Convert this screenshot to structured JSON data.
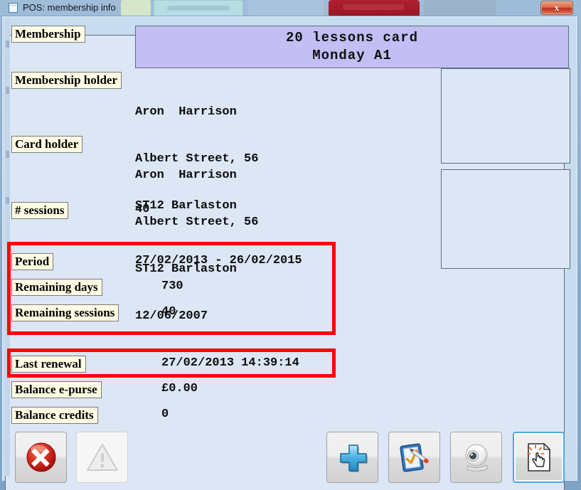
{
  "window": {
    "title": "POS: membership info",
    "icon": "window-icon",
    "close_label": "x"
  },
  "background_strips": [
    {
      "name": "bg-window-green",
      "color": "#d7e6c8"
    },
    {
      "name": "bg-window-cyan",
      "color": "#b6dde4"
    },
    {
      "name": "bg-window-blue",
      "color": "#a8c2dd"
    },
    {
      "name": "bg-window-red",
      "color": "#a71d2a"
    },
    {
      "name": "bg-window-gray",
      "color": "#9bb4cc"
    }
  ],
  "membership": {
    "section_label": "Membership",
    "card_title_line1": "20 lessons card",
    "card_title_line2": "Monday A1",
    "card_bg": "#c3bef4"
  },
  "membership_holder": {
    "label": "Membership holder",
    "line1": "Aron  Harrison",
    "line2": "Albert Street, 56",
    "line3": "ST12 Barlaston"
  },
  "card_holder": {
    "label": "Card holder",
    "line1": "Aron  Harrison",
    "line2": "Albert Street, 56",
    "line3": "ST12 Barlaston",
    "line4": "12/06/2007"
  },
  "sessions": {
    "label": "# sessions",
    "value": "40"
  },
  "period": {
    "label": "Period",
    "value": "27/02/2013 - 26/02/2015"
  },
  "remaining_days": {
    "label": "Remaining days",
    "value": "730"
  },
  "remaining_sessions": {
    "label": "Remaining sessions",
    "value": "40"
  },
  "last_renewal": {
    "label": "Last renewal",
    "value": "27/02/2013 14:39:14"
  },
  "balance_epurse": {
    "label": "Balance e-purse",
    "value": "£0.00"
  },
  "balance_credits": {
    "label": "Balance credits",
    "value": "0"
  },
  "photos": [
    {
      "name": "photo-placeholder-1"
    },
    {
      "name": "photo-placeholder-2"
    }
  ],
  "annotations": {
    "highlight_color": "#ff0000",
    "boxes": [
      {
        "name": "highlight-period-block"
      },
      {
        "name": "highlight-last-renewal"
      }
    ]
  },
  "toolbar": {
    "buttons": [
      {
        "name": "cancel-button",
        "icon": "red-circle-x-icon",
        "enabled": true
      },
      {
        "name": "warning-button",
        "icon": "warning-triangle-icon",
        "enabled": false
      },
      {
        "name": "add-button",
        "icon": "blue-plus-icon",
        "enabled": true
      },
      {
        "name": "edit-button",
        "icon": "form-checkmark-pen-icon",
        "enabled": true
      },
      {
        "name": "webcam-button",
        "icon": "webcam-icon",
        "enabled": true
      },
      {
        "name": "signature-button",
        "icon": "document-hand-click-icon",
        "enabled": true,
        "focused": true
      }
    ]
  }
}
